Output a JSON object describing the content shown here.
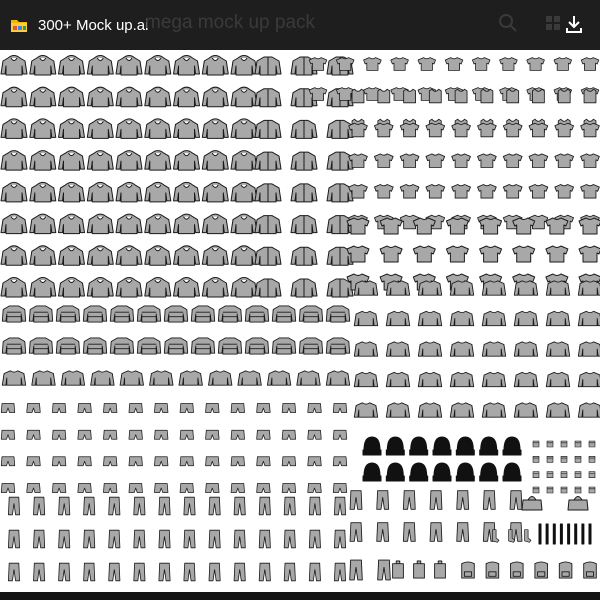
{
  "header": {
    "title": "300+ Mock up.ai",
    "ghost_title": "mega mock up pack",
    "file_icon": "file-icon",
    "download_icon": "download-icon"
  },
  "sheet": {
    "content": "grid of garment mock-up templates",
    "fill": "#a8a8a8",
    "outline": "#1a1a1a",
    "accessory_fill": "#111111"
  },
  "colors": {
    "topbar": "#1e1e1e",
    "title": "#ffffff",
    "background": "#ffffff"
  }
}
